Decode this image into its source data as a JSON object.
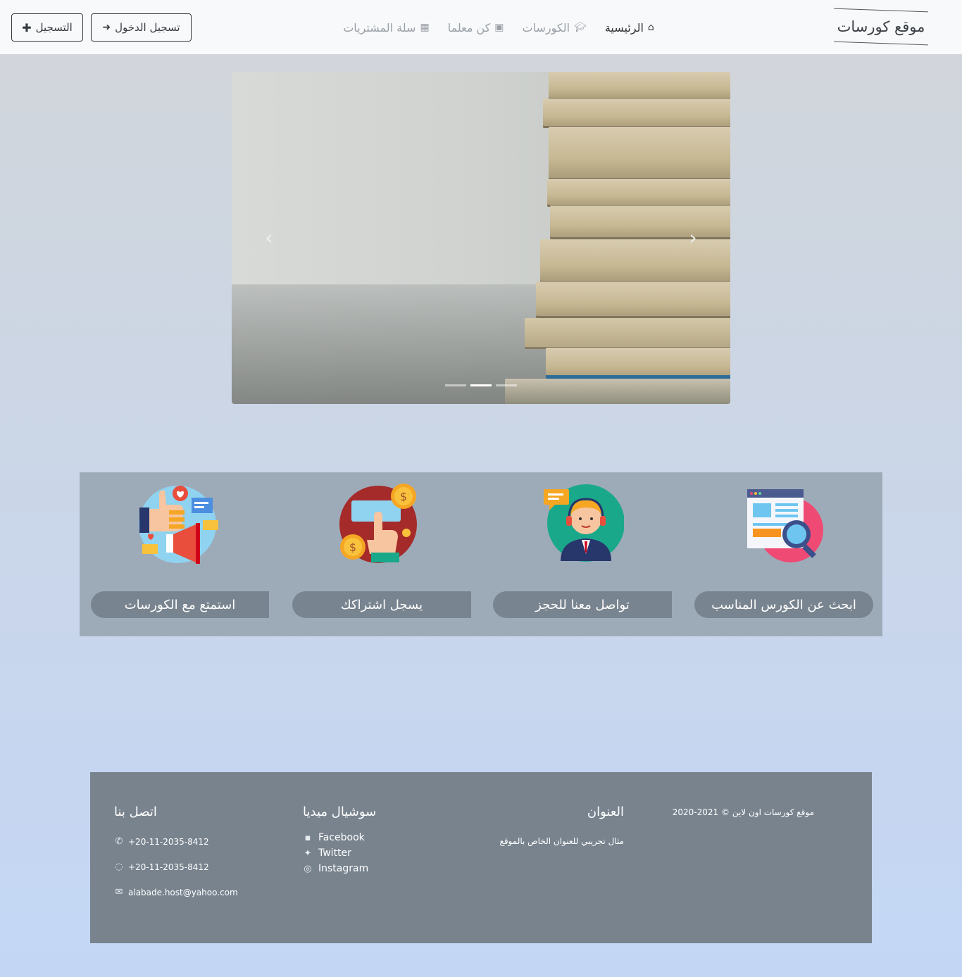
{
  "navbar": {
    "brand": "موقع كورسات",
    "links": [
      {
        "label": "الرئيسية",
        "icon": "home-icon",
        "active": true
      },
      {
        "label": "الكورسات",
        "icon": "graduation-cap-icon",
        "active": false
      },
      {
        "label": "كن معلما",
        "icon": "teacher-icon",
        "active": false
      },
      {
        "label": "سلة المشتريات",
        "icon": "basket-icon",
        "active": false
      }
    ],
    "login_label": "تسجيل الدخول",
    "register_label": "التسجيل"
  },
  "carousel": {
    "prev_icon": "chevron-left-icon",
    "next_icon": "chevron-right-icon",
    "slide_count": 3,
    "active_index": 1
  },
  "features": [
    {
      "label": "ابحث عن الكورس المناسب",
      "icon": "search-web-icon"
    },
    {
      "label": "تواصل معنا للحجز",
      "icon": "support-agent-icon"
    },
    {
      "label": "يسجل اشتراكك",
      "icon": "payment-click-icon"
    },
    {
      "label": "استمتع مع الكورسات",
      "icon": "like-marketing-icon"
    }
  ],
  "footer": {
    "copyright": "موقع كورسات اون لاين © 2021-2020",
    "address_title": "العنوان",
    "address_text": "مثال تجريبي للعنوان الخاص بالموقع",
    "social_title": "سوشيال ميديا",
    "social": [
      {
        "label": "Facebook",
        "icon": "facebook-icon"
      },
      {
        "label": "Twitter",
        "icon": "twitter-icon"
      },
      {
        "label": "Instagram",
        "icon": "instagram-icon"
      }
    ],
    "contact_title": "اتصل بنا",
    "phone": "+20-11-2035-8412",
    "whatsapp": "+20-11-2035-8412",
    "email": "alabade.host@yahoo.com"
  },
  "colors": {
    "navbar_bg": "#f8f9fa",
    "features_bg": "#9dabb9",
    "feature_label_bg": "#78848f",
    "footer_bg": "#78838e"
  }
}
